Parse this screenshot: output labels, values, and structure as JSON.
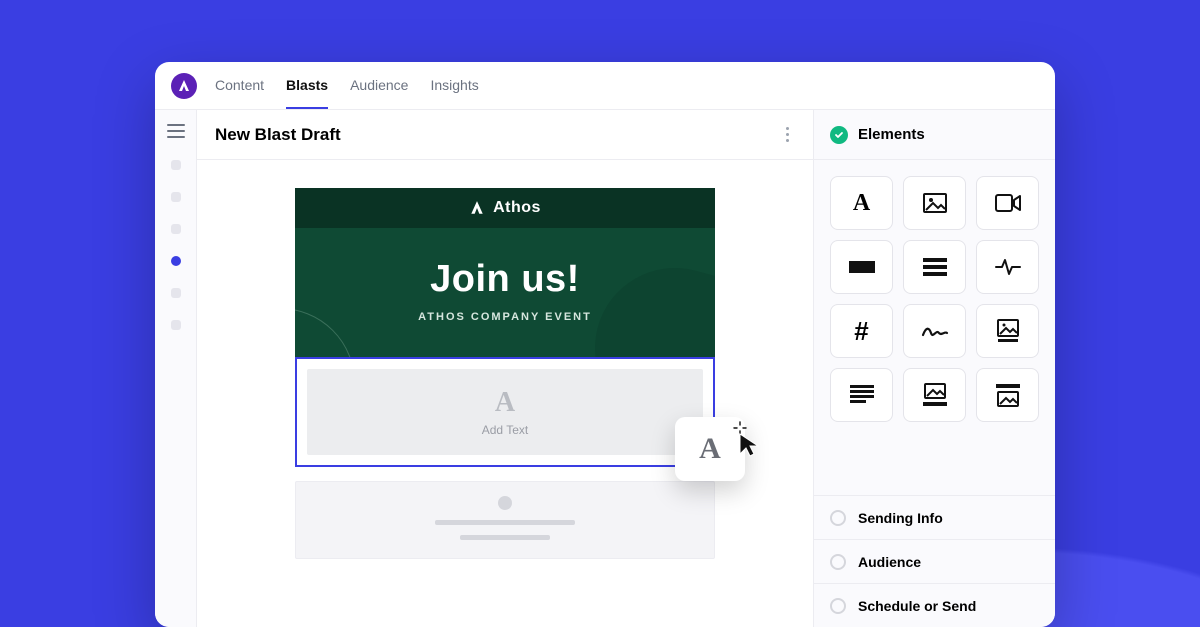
{
  "nav": {
    "tabs": [
      "Content",
      "Blasts",
      "Audience",
      "Insights"
    ],
    "active_index": 1
  },
  "editor": {
    "title": "New Blast Draft",
    "hero": {
      "brand": "Athos",
      "headline": "Join us!",
      "subhead": "ATHOS COMPANY EVENT"
    },
    "drop_slot_label": "Add Text"
  },
  "right_panel": {
    "active_section": "Elements",
    "sections": [
      "Sending Info",
      "Audience",
      "Schedule or Send"
    ],
    "elements": [
      {
        "id": "text-element",
        "icon": "text"
      },
      {
        "id": "image-element",
        "icon": "image"
      },
      {
        "id": "video-element",
        "icon": "video"
      },
      {
        "id": "button-element",
        "icon": "button"
      },
      {
        "id": "list-element",
        "icon": "list"
      },
      {
        "id": "activity-element",
        "icon": "activity"
      },
      {
        "id": "hashtag-element",
        "icon": "hash"
      },
      {
        "id": "signature-element",
        "icon": "signature"
      },
      {
        "id": "gallery-element",
        "icon": "gallery"
      },
      {
        "id": "paragraph-element",
        "icon": "paragraph"
      },
      {
        "id": "image-caption-bottom-element",
        "icon": "image-caption-bottom"
      },
      {
        "id": "image-caption-top-element",
        "icon": "image-caption-top"
      }
    ]
  },
  "colors": {
    "accent": "#3a3ee2",
    "hero_bg": "#0f4a34",
    "hero_top": "#0a3324",
    "success": "#10b981"
  }
}
